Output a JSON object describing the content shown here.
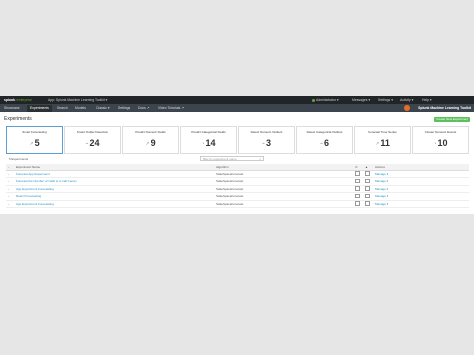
{
  "topbar": {
    "brand": "splunk",
    "brand_suffix": ">enterprise",
    "app": "App: Splunk Machine Learning Toolkit ▾",
    "admin": "Administrator ▾",
    "messages": "Messages ▾",
    "settings": "Settings ▾",
    "activity": "Activity ▾",
    "help": "Help ▾"
  },
  "appbar": {
    "tabs": [
      "Showcase",
      "Experiments",
      "Search",
      "Models",
      "Classic ▾",
      "Settings",
      "Docs ↗",
      "Video Tutorials ↗"
    ],
    "title": "Splunk Machine Learning Toolkit"
  },
  "page": {
    "title": "Experiments",
    "create_button": "Create New Experiment"
  },
  "cards": [
    {
      "label": "Smart Forecasting",
      "value": "5",
      "icon": "↗"
    },
    {
      "label": "Smart Outlier Detection",
      "value": "24",
      "icon": "⌁"
    },
    {
      "label": "Predict Numeric Fields",
      "value": "9",
      "icon": "↗"
    },
    {
      "label": "Predict Categorical Fields",
      "value": "14",
      "icon": "◔"
    },
    {
      "label": "Detect Numeric Outliers",
      "value": "3",
      "icon": "⌁"
    },
    {
      "label": "Detect Categorical Outliers",
      "value": "6",
      "icon": "⌁"
    },
    {
      "label": "Forecast Time Series",
      "value": "11",
      "icon": "↗"
    },
    {
      "label": "Cluster Numeric Events",
      "value": "10",
      "icon": "◔"
    }
  ],
  "list": {
    "count": "5 Experiments",
    "filter_placeholder": "filter by experiment name",
    "headers": [
      "Experiment Name",
      "Algorithm",
      "",
      "",
      "Actions"
    ],
    "rows": [
      {
        "name": "Forecast App Experiment",
        "algorithm": "StateSpaceForecast",
        "action": "Manage ▾"
      },
      {
        "name": "Forecast the Number of Calls to a Call Center",
        "algorithm": "StateSpaceForecast",
        "action": "Manage ▾"
      },
      {
        "name": "App Experiment Forecasting",
        "algorithm": "StateSpaceForecast",
        "action": "Manage ▾"
      },
      {
        "name": "Detect Forecasting",
        "algorithm": "StateSpaceForecast",
        "action": "Manage ▾"
      },
      {
        "name": "App Experiment Forecasting",
        "algorithm": "StateSpaceForecast",
        "action": "Manage ▾"
      }
    ]
  }
}
